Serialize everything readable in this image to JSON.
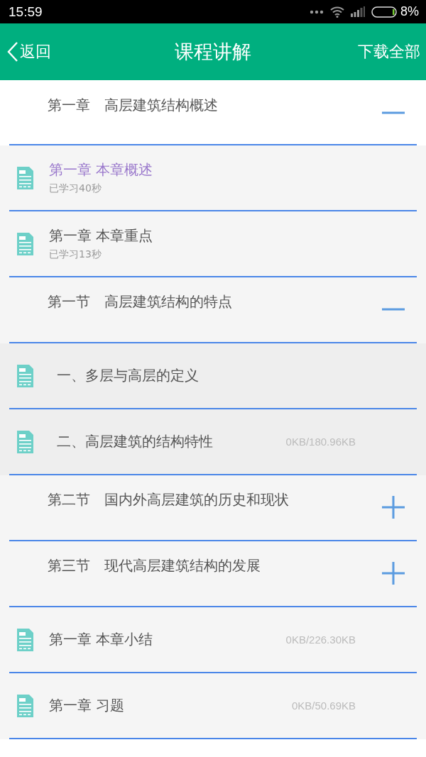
{
  "status_bar": {
    "time": "15:59",
    "battery": "8%"
  },
  "header": {
    "back": "返回",
    "title": "课程讲解",
    "action": "下载全部"
  },
  "outline": [
    {
      "kind": "chapter",
      "title": "第一章　高层建筑结构概述",
      "expanded": true,
      "children": [
        {
          "kind": "lesson",
          "title": "第一章 本章概述",
          "progress": "已学习40秒",
          "visited": true
        },
        {
          "kind": "lesson",
          "title": "第一章 本章重点",
          "progress": "已学习13秒",
          "visited": false
        },
        {
          "kind": "section",
          "title": "第一节　高层建筑结构的特点",
          "expanded": true,
          "children": [
            {
              "kind": "lesson",
              "title": "一、多层与高层的定义",
              "visited": false
            },
            {
              "kind": "lesson",
              "title": "二、高层建筑的结构特性",
              "size": "0KB/180.96KB",
              "visited": false
            }
          ]
        },
        {
          "kind": "section",
          "title": "第二节　国内外高层建筑的历史和现状",
          "expanded": false
        },
        {
          "kind": "section",
          "title": "第三节　现代高层建筑结构的发展",
          "expanded": false
        },
        {
          "kind": "lesson",
          "title": "第一章 本章小结",
          "size": "0KB/226.30KB",
          "visited": false
        },
        {
          "kind": "lesson",
          "title": "第一章 习题",
          "size": "0KB/50.69KB",
          "visited": false
        }
      ]
    }
  ]
}
